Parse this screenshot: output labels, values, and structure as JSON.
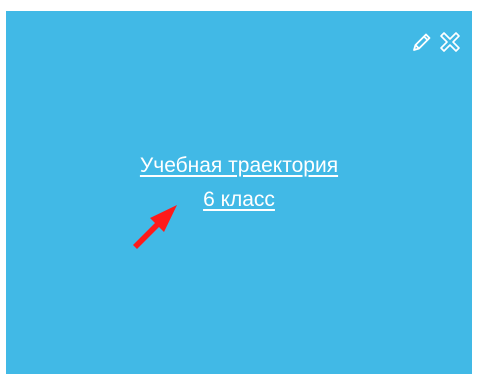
{
  "tile": {
    "background": "#41b9e6",
    "link_line1": "Учебная траектория",
    "link_line2": "6 класс",
    "icons": [
      "pencil-icon",
      "close-icon"
    ]
  },
  "annotation": {
    "color": "#ff1a1a"
  }
}
